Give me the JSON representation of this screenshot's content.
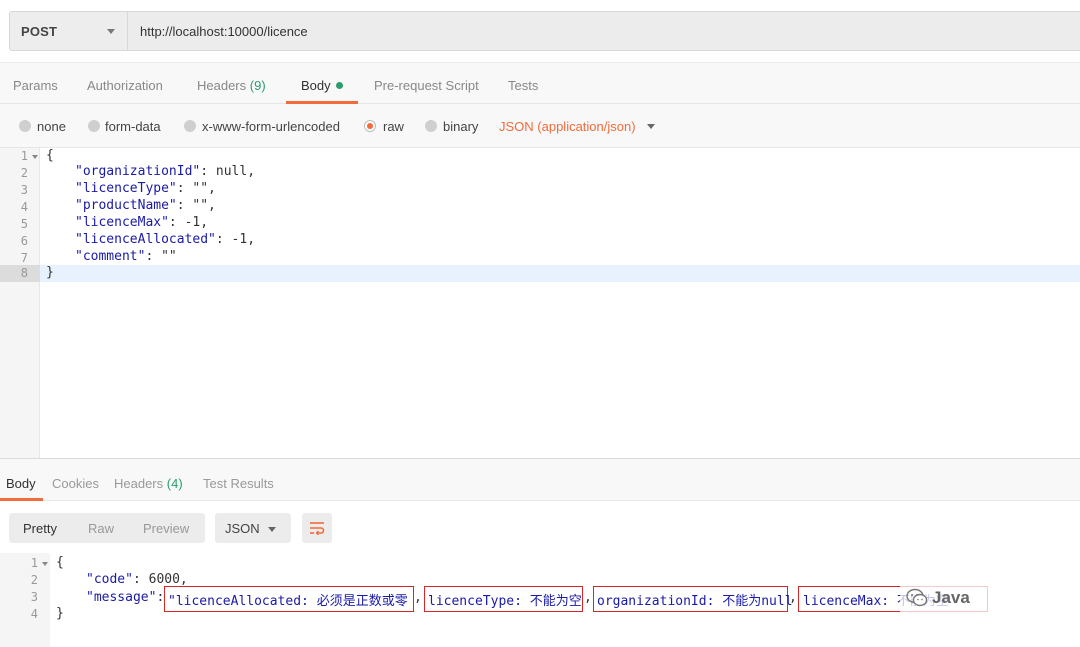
{
  "request": {
    "method": "POST",
    "url": "http://localhost:10000/licence"
  },
  "req_tabs": [
    {
      "label": "Params"
    },
    {
      "label": "Authorization"
    },
    {
      "label": "Headers",
      "count": "(9)"
    },
    {
      "label": "Body"
    },
    {
      "label": "Pre-request Script"
    },
    {
      "label": "Tests"
    }
  ],
  "body_types": [
    "none",
    "form-data",
    "x-www-form-urlencoded",
    "raw",
    "binary"
  ],
  "body_format": "JSON (application/json)",
  "request_lines": [
    "1",
    "2",
    "3",
    "4",
    "5",
    "6",
    "7",
    "8"
  ],
  "request_body": {
    "open": "{",
    "l2k": "\"organizationId\"",
    "l2v": ": null,",
    "l3k": "\"licenceType\"",
    "l3v": ": \"\",",
    "l4k": "\"productName\"",
    "l4v": ": \"\",",
    "l5k": "\"licenceMax\"",
    "l5v": ": -1,",
    "l6k": "\"licenceAllocated\"",
    "l6v": ": -1,",
    "l7k": "\"comment\"",
    "l7v": ": \"\"",
    "close": "}"
  },
  "resp_tabs": [
    {
      "label": "Body"
    },
    {
      "label": "Cookies"
    },
    {
      "label": "Headers",
      "count": "(4)"
    },
    {
      "label": "Test Results"
    }
  ],
  "view_modes": [
    "Pretty",
    "Raw",
    "Preview"
  ],
  "resp_format": "JSON",
  "response_lines": [
    "1",
    "2",
    "3",
    "4"
  ],
  "response": {
    "open": "{",
    "code_key": "\"code\"",
    "code_val": ": 6000,",
    "msg_key": "\"message\"",
    "msg_colon": ": ",
    "msg_seg1": "\"licenceAllocated: 必须是正数或零",
    "msg_seg2": "licenceType: 不能为空",
    "msg_seg3": "organizationId: 不能为null",
    "msg_seg4": "licenceMax: 不能为空",
    "close": "}"
  },
  "watermark": "Java",
  "icons": {
    "wrap": "wrap-lines-icon",
    "logo": "wechat-logo-icon"
  },
  "colors": {
    "accent": "#f26b3a",
    "green": "#2a9d6f",
    "string": "#1a1aa6",
    "box": "#d62728"
  }
}
